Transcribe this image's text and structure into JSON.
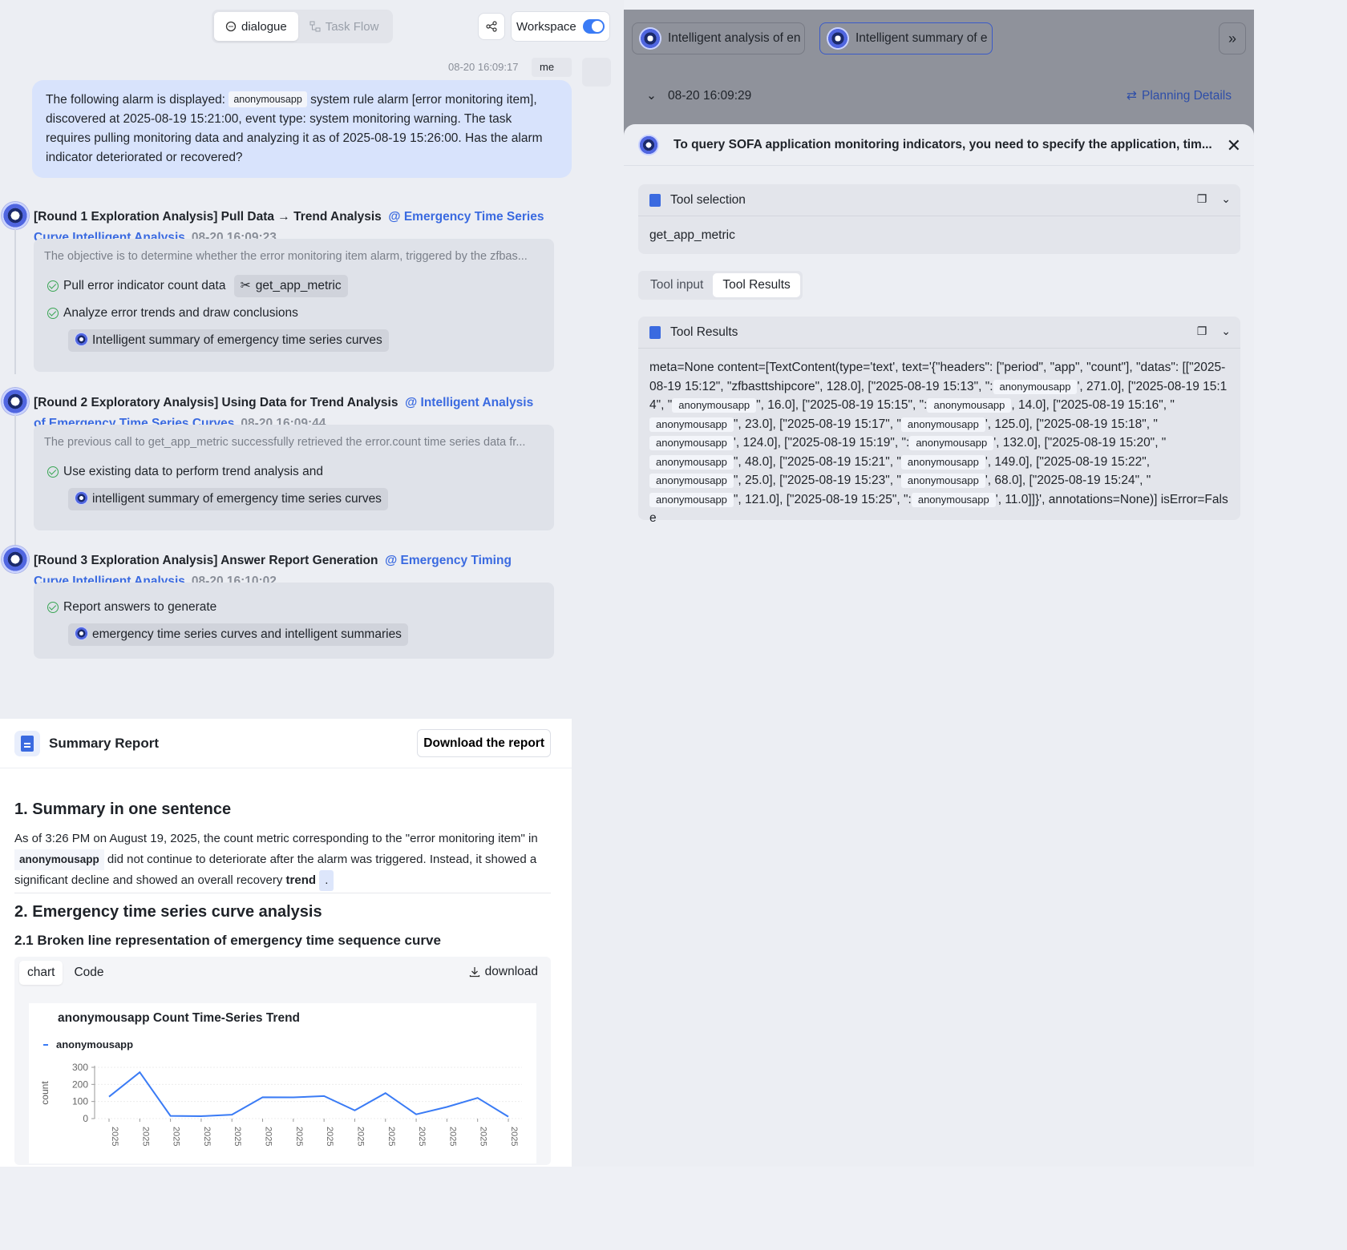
{
  "top": {
    "tab_dialogue": "dialogue",
    "tab_taskflow": "Task Flow",
    "workspace": "Workspace"
  },
  "user_msg": {
    "time": "08-20 16:09:17",
    "sender": "me",
    "text_before": "The following alarm is displayed: ",
    "app_chip": "anonymousapp",
    "text_after": " system rule alarm [error monitoring item], discovered at 2025-08-19 15:21:00, event type: system monitoring warning. The task requires pulling monitoring data and analyzing it as of 2025-08-19 15:26:00. Has the alarm indicator deteriorated or recovered?"
  },
  "rounds": [
    {
      "title": "[Round 1 Exploration Analysis] Pull Data → Trend Analysis",
      "agent": "@ Emergency Time Series Curve Intelligent Analysis",
      "time": "08-20 16:09:23",
      "desc": "The objective is to determine whether the error monitoring item alarm, triggered by the zfbas...",
      "step1": "Pull error indicator count data",
      "step1_tool": "get_app_metric",
      "step2": "Analyze error trends and draw conclusions",
      "step2_tool": "Intelligent summary of emergency time series curves"
    },
    {
      "title": "[Round 2 Exploratory Analysis] Using Data for Trend Analysis",
      "agent": "@ Intelligent Analysis of Emergency Time Series Curves",
      "time": "08-20 16:09:44",
      "desc": "The previous call to get_app_metric successfully retrieved the error.count time series data fr...",
      "step1": "Use existing data to perform trend analysis and",
      "step1_tool": "intelligent summary of emergency time series curves"
    },
    {
      "title": "[Round 3 Exploration Analysis] Answer Report Generation",
      "agent": "@ Emergency Timing Curve Intelligent Analysis",
      "time": "08-20 16:10:02",
      "step1": "Report answers to generate",
      "step1_tool": "emergency time series curves and intelligent summaries"
    }
  ],
  "report": {
    "title": "Summary Report",
    "download": "Download the report",
    "h1": "1. Summary in one sentence",
    "p_before": "As of 3:26 PM on August 19, 2025, the count metric corresponding to the \"error monitoring item\" in ",
    "p_chip": "anonymousapp",
    "p_after": " did not continue to deteriorate after the alarm was triggered. Instead, it showed a significant decline and showed an overall recovery ",
    "p_bold": "trend",
    "p_dot": ".",
    "h2": "2. Emergency time series curve analysis",
    "h3": "2.1 Broken line representation of emergency time sequence curve",
    "tab_chart": "chart",
    "tab_code": "Code",
    "chart_download": "download"
  },
  "chart_data": {
    "type": "line",
    "title": "anonymousapp Count Time-Series Trend",
    "ylabel": "count",
    "ylim": [
      0,
      300
    ],
    "yticks": [
      0,
      100,
      200,
      300
    ],
    "x": [
      "2025-08-19 15:12",
      "2025-08-19 15:13",
      "2025-08-19 15:14",
      "2025-08-19 15:15",
      "2025-08-19 15:16",
      "2025-08-19 15:17",
      "2025-08-19 15:18",
      "2025-08-19 15:19",
      "2025-08-19 15:20",
      "2025-08-19 15:21",
      "2025-08-19 15:22",
      "2025-08-19 15:23",
      "2025-08-19 15:24",
      "2025-08-19 15:25"
    ],
    "tick_label": "2025",
    "series": [
      {
        "name": "anonymousapp",
        "color": "#3a7bf5",
        "values": [
          128,
          271,
          16,
          14,
          23,
          125,
          124,
          132,
          48,
          149,
          25,
          68,
          121,
          11
        ]
      }
    ],
    "legend": "top-left"
  },
  "right": {
    "tab1": "Intelligent analysis of en",
    "tab2": "Intelligent summary of e",
    "time": "08-20 16:09:29",
    "plan": "Planning Details",
    "drawer_title": "To query SOFA application monitoring indicators, you need to specify the application, tim...",
    "tool_sel_title": "Tool selection",
    "tool_sel_value": "get_app_metric",
    "seg_input": "Tool input",
    "seg_results": "Tool Results",
    "results_title": "Tool Results",
    "r1": "meta=None content=[TextContent(type='text', text='{\"headers\": [\"period\", \"app\", \"count\"], \"datas\": [[\"2025-08-19 15:12\", \"zfbasttshipcore\", 128.0], [\"2025-08-19 15:13\", \":",
    "chip": "anonymousapp",
    "r2": "', 271.0], [\"2025-08-19 15:14\", \"",
    "r3": "\", 16.0], [\"2025-08-19 15:15\", \":",
    "r4": ", 14.0], [\"2025-08-19 15:16\", \"",
    "r5": "\", 23.0], [\"2025-08-19 15:17\", \"",
    "r6": "', 125.0], [\"2025-08-19 15:18\", \"",
    "r7": "', 124.0], [\"2025-08-19 15:19\", \":",
    "r8": "', 132.0], [\"2025-08-19 15:20\", \"",
    "r9": "\", 48.0], [\"2025-08-19 15:21\", \"",
    "r10": "', 149.0], [\"2025-08-19 15:22\", ",
    "r11": "\", 25.0], [\"2025-08-19 15:23\", \"",
    "r12": "', 68.0], [\"2025-08-19 15:24\", \"",
    "r13": "\", 121.0], [\"2025-08-19 15:25\", \":",
    "r14": "', 11.0]]}', annotations=None)] isError=False"
  }
}
